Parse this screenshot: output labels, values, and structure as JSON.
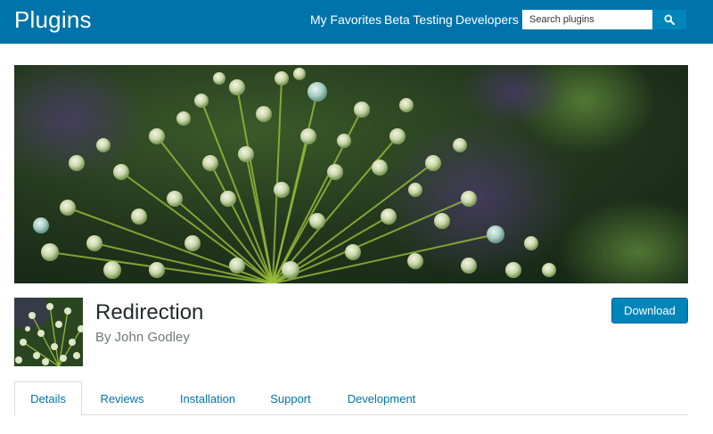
{
  "header": {
    "brand": "Plugins",
    "nav": [
      "My Favorites",
      "Beta Testing",
      "Developers"
    ],
    "search_placeholder": "Search plugins",
    "search_icon": "search-icon"
  },
  "plugin": {
    "title": "Redirection",
    "author": "By John Godley",
    "download_label": "Download"
  },
  "tabs": [
    "Details",
    "Reviews",
    "Installation",
    "Support",
    "Development"
  ],
  "active_tab": "Details",
  "colors": {
    "header": "#0073aa",
    "button": "#0085ba",
    "link": "#0073aa"
  }
}
